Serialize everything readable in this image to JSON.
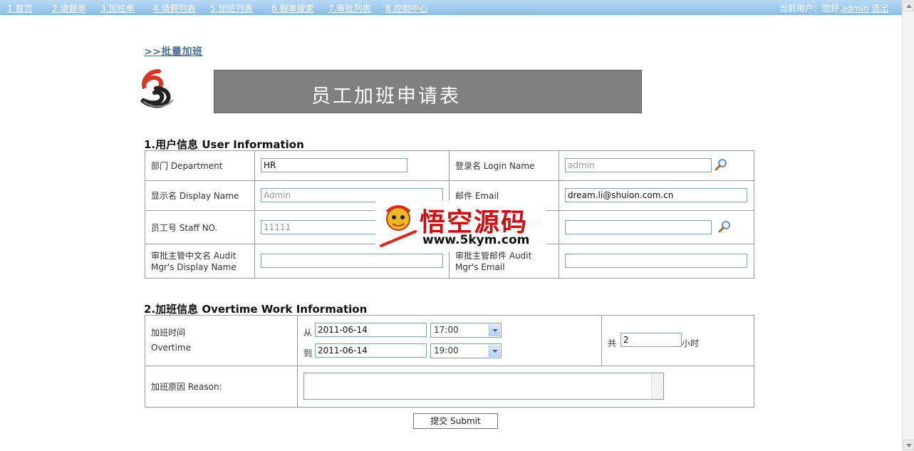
{
  "nav": {
    "items": [
      "1.首页",
      "2.请假单",
      "3.加班单",
      "4.请假列表",
      "5.加班列表",
      "6.假单搜索",
      "7.审批列表",
      "8.控制中心"
    ],
    "user_prefix": "当前用户：您好,",
    "user_name": "admin",
    "logout": "退出"
  },
  "batch_link": ">>批量加班",
  "banner_title": "员工加班申请表",
  "section1": {
    "title": "1.用户信息 User Information",
    "department_label": "部门 Department",
    "department_value": "HR",
    "login_label": "登录名 Login Name",
    "login_value": "admin",
    "display_label": "显示名 Display Name",
    "display_value": "Admin",
    "email_label": "邮件 Email",
    "email_value": "dream.li@shuion.com.cn",
    "staff_label": "员工号 Staff NO.",
    "staff_value": "11111",
    "audit_partial_label": "it",
    "audit_value": "",
    "mgr_display_label_1": "审批主管中文名 Audit",
    "mgr_display_label_2": "Mgr's Display Name",
    "mgr_display_value": "",
    "mgr_email_label_1": "审批主管邮件 Audit",
    "mgr_email_label_2": "Mgr's Email",
    "mgr_email_value": ""
  },
  "section2": {
    "title": "2.加班信息 Overtime Work Information",
    "time_label_cn": "加班时间",
    "time_label_en": "Overtime",
    "from_label": "从",
    "from_date": "2011-06-14",
    "from_time": "17:00",
    "to_label": "到",
    "to_date": "2011-06-14",
    "to_time": "19:00",
    "total_prefix": "共",
    "total_hours": "2",
    "total_suffix": "小时",
    "reason_label": "加班原因 Reason:",
    "reason_value": ""
  },
  "submit_label": "提交 Submit",
  "watermark": {
    "title": "悟空源码",
    "url": "www.5kym.com"
  },
  "icons": {
    "lookup": "magnifier-icon",
    "logo": "swirl-logo-icon"
  }
}
